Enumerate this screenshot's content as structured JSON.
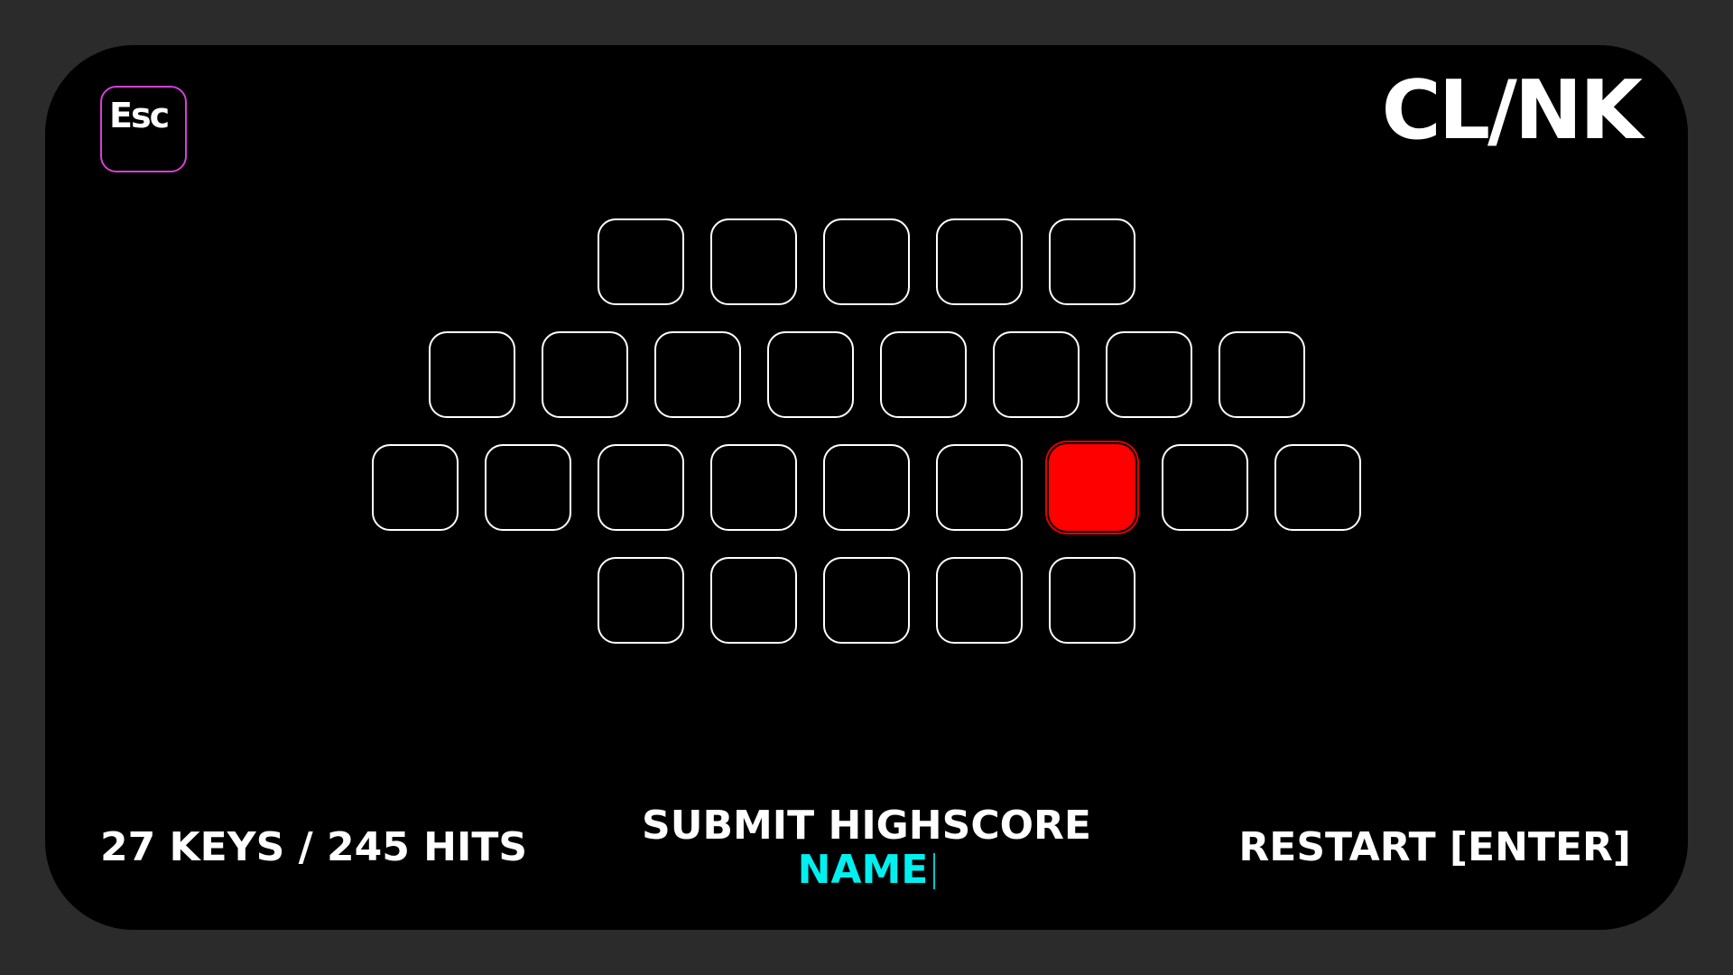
{
  "esc_key": {
    "label": "Esc"
  },
  "logo": {
    "text": "CL/NK"
  },
  "keyboard": {
    "rows": [
      {
        "count": 5
      },
      {
        "count": 8
      },
      {
        "count": 9
      },
      {
        "count": 5
      }
    ],
    "active_key": {
      "row": 2,
      "index": 6
    },
    "colors": {
      "outline": "#ffffff",
      "active": "#ff0000",
      "esc_outline": "#d63fd6"
    }
  },
  "footer": {
    "stats": "27 KEYS / 245 HITS",
    "submit_title": "SUBMIT HIGHSCORE",
    "name_value": "NAME",
    "name_color": "#00f0f0",
    "restart": "RESTART [ENTER]"
  }
}
